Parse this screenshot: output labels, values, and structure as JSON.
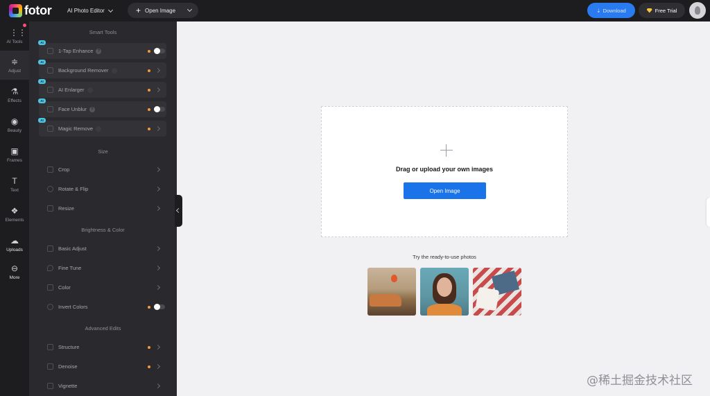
{
  "topbar": {
    "logo_text": "fotor",
    "editor_label": "AI Photo Editor",
    "open_image_label": "Open Image",
    "download_label": "Download",
    "free_trial_label": "Free Trial"
  },
  "rail": {
    "items": [
      {
        "label": "AI Tools",
        "icon": "grid-icon"
      },
      {
        "label": "Adjust",
        "icon": "sliders-icon"
      },
      {
        "label": "Effects",
        "icon": "flask-icon"
      },
      {
        "label": "Beauty",
        "icon": "eye-icon"
      },
      {
        "label": "Frames",
        "icon": "frame-icon"
      },
      {
        "label": "Text",
        "icon": "text-icon"
      },
      {
        "label": "Elements",
        "icon": "shapes-icon"
      },
      {
        "label": "Uploads",
        "icon": "cloud-upload-icon"
      },
      {
        "label": "More",
        "icon": "more-icon"
      }
    ]
  },
  "panel": {
    "sections": [
      {
        "title": "Smart Tools"
      },
      {
        "title": "Size"
      },
      {
        "title": "Brightness & Color"
      },
      {
        "title": "Advanced Edits"
      }
    ],
    "badge": "AI",
    "tools": [
      {
        "label": "1-Tap Enhance"
      },
      {
        "label": "Background Remover"
      },
      {
        "label": "AI Enlarger"
      },
      {
        "label": "Face Unblur"
      },
      {
        "label": "Magic Remove"
      },
      {
        "label": "Crop"
      },
      {
        "label": "Rotate & Flip"
      },
      {
        "label": "Resize"
      },
      {
        "label": "Basic Adjust"
      },
      {
        "label": "Fine Tune"
      },
      {
        "label": "Color"
      },
      {
        "label": "Invert Colors"
      },
      {
        "label": "Structure"
      },
      {
        "label": "Denoise"
      },
      {
        "label": "Vignette"
      }
    ]
  },
  "canvas": {
    "upload_title": "Drag or upload your own images",
    "open_button": "Open Image",
    "try_label": "Try the ready-to-use photos"
  },
  "watermark": "@稀土掘金技术社区",
  "colors": {
    "accent": "#1a73e8",
    "panel_bg": "#2a2a2e",
    "topbar_bg": "#1d1d20",
    "canvas_bg": "#f1f1f4",
    "dot": "#f59a3a"
  }
}
